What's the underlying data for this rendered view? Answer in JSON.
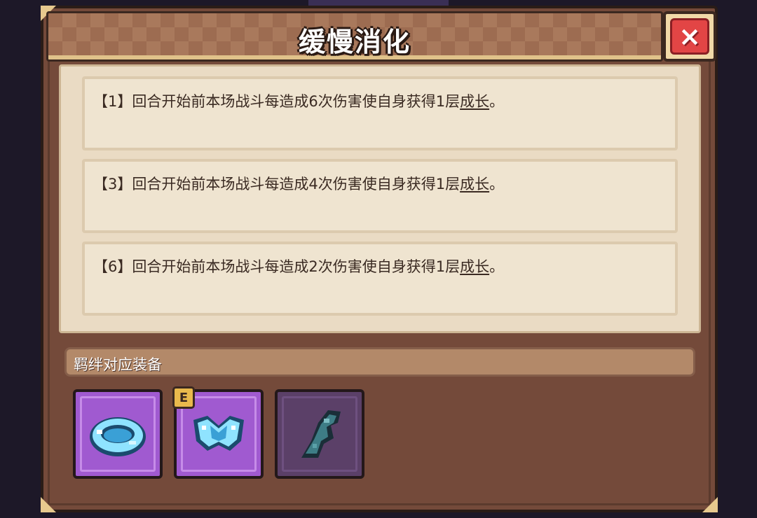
{
  "title": "缓慢消化",
  "close_label": "×",
  "effects": [
    {
      "text": "【1】回合开始前本场战斗每造成6次伤害使自身获得1层",
      "keyword": "成长",
      "end": "。"
    },
    {
      "text": "【3】回合开始前本场战斗每造成4次伤害使自身获得1层",
      "keyword": "成长",
      "end": "。"
    },
    {
      "text": "【6】回合开始前本场战斗每造成2次伤害使自身获得1层",
      "keyword": "成长",
      "end": "。"
    }
  ],
  "section_label": "羁绊对应装备",
  "items": [
    {
      "icon": "crystal-ring-icon",
      "state": "owned",
      "badge": ""
    },
    {
      "icon": "crystal-armor-icon",
      "state": "owned",
      "badge": "E"
    },
    {
      "icon": "crystal-gauntlet-icon",
      "state": "locked",
      "badge": ""
    }
  ],
  "colors": {
    "panel": "#744a3a",
    "header": "#9d6c51",
    "content": "#eadbc4",
    "close_red": "#e24545",
    "item_owned": "#a05ad0",
    "item_locked": "#5b4068",
    "badge": "#e9b94c"
  }
}
